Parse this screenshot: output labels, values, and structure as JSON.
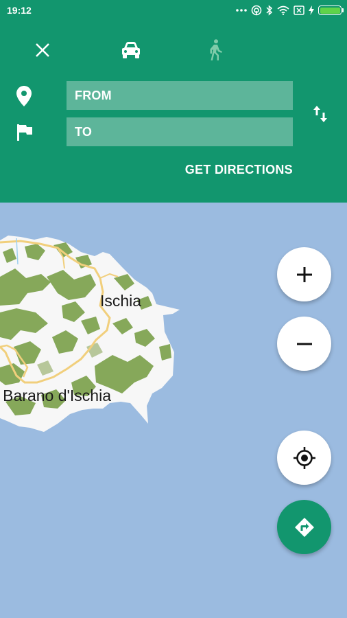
{
  "status_bar": {
    "time": "19:12"
  },
  "directions_panel": {
    "modes": [
      {
        "name": "close",
        "icon": "close-icon"
      },
      {
        "name": "car",
        "icon": "car-icon",
        "selected": true
      },
      {
        "name": "walk",
        "icon": "walk-icon",
        "selected": false
      }
    ],
    "from_placeholder": "FROM",
    "to_placeholder": "TO",
    "get_directions_label": "GET DIRECTIONS"
  },
  "map": {
    "labels": {
      "town_1": "Ischia",
      "town_2": "Barano d'Ischia"
    }
  },
  "controls": {
    "zoom_in": "+",
    "zoom_out": "−"
  },
  "colors": {
    "primary": "#12966e",
    "field": "#5db59a",
    "water": "#9bbbe0",
    "land": "#f7f7f7",
    "vegetation": "#86a85a",
    "road": "#f1cf7c"
  }
}
